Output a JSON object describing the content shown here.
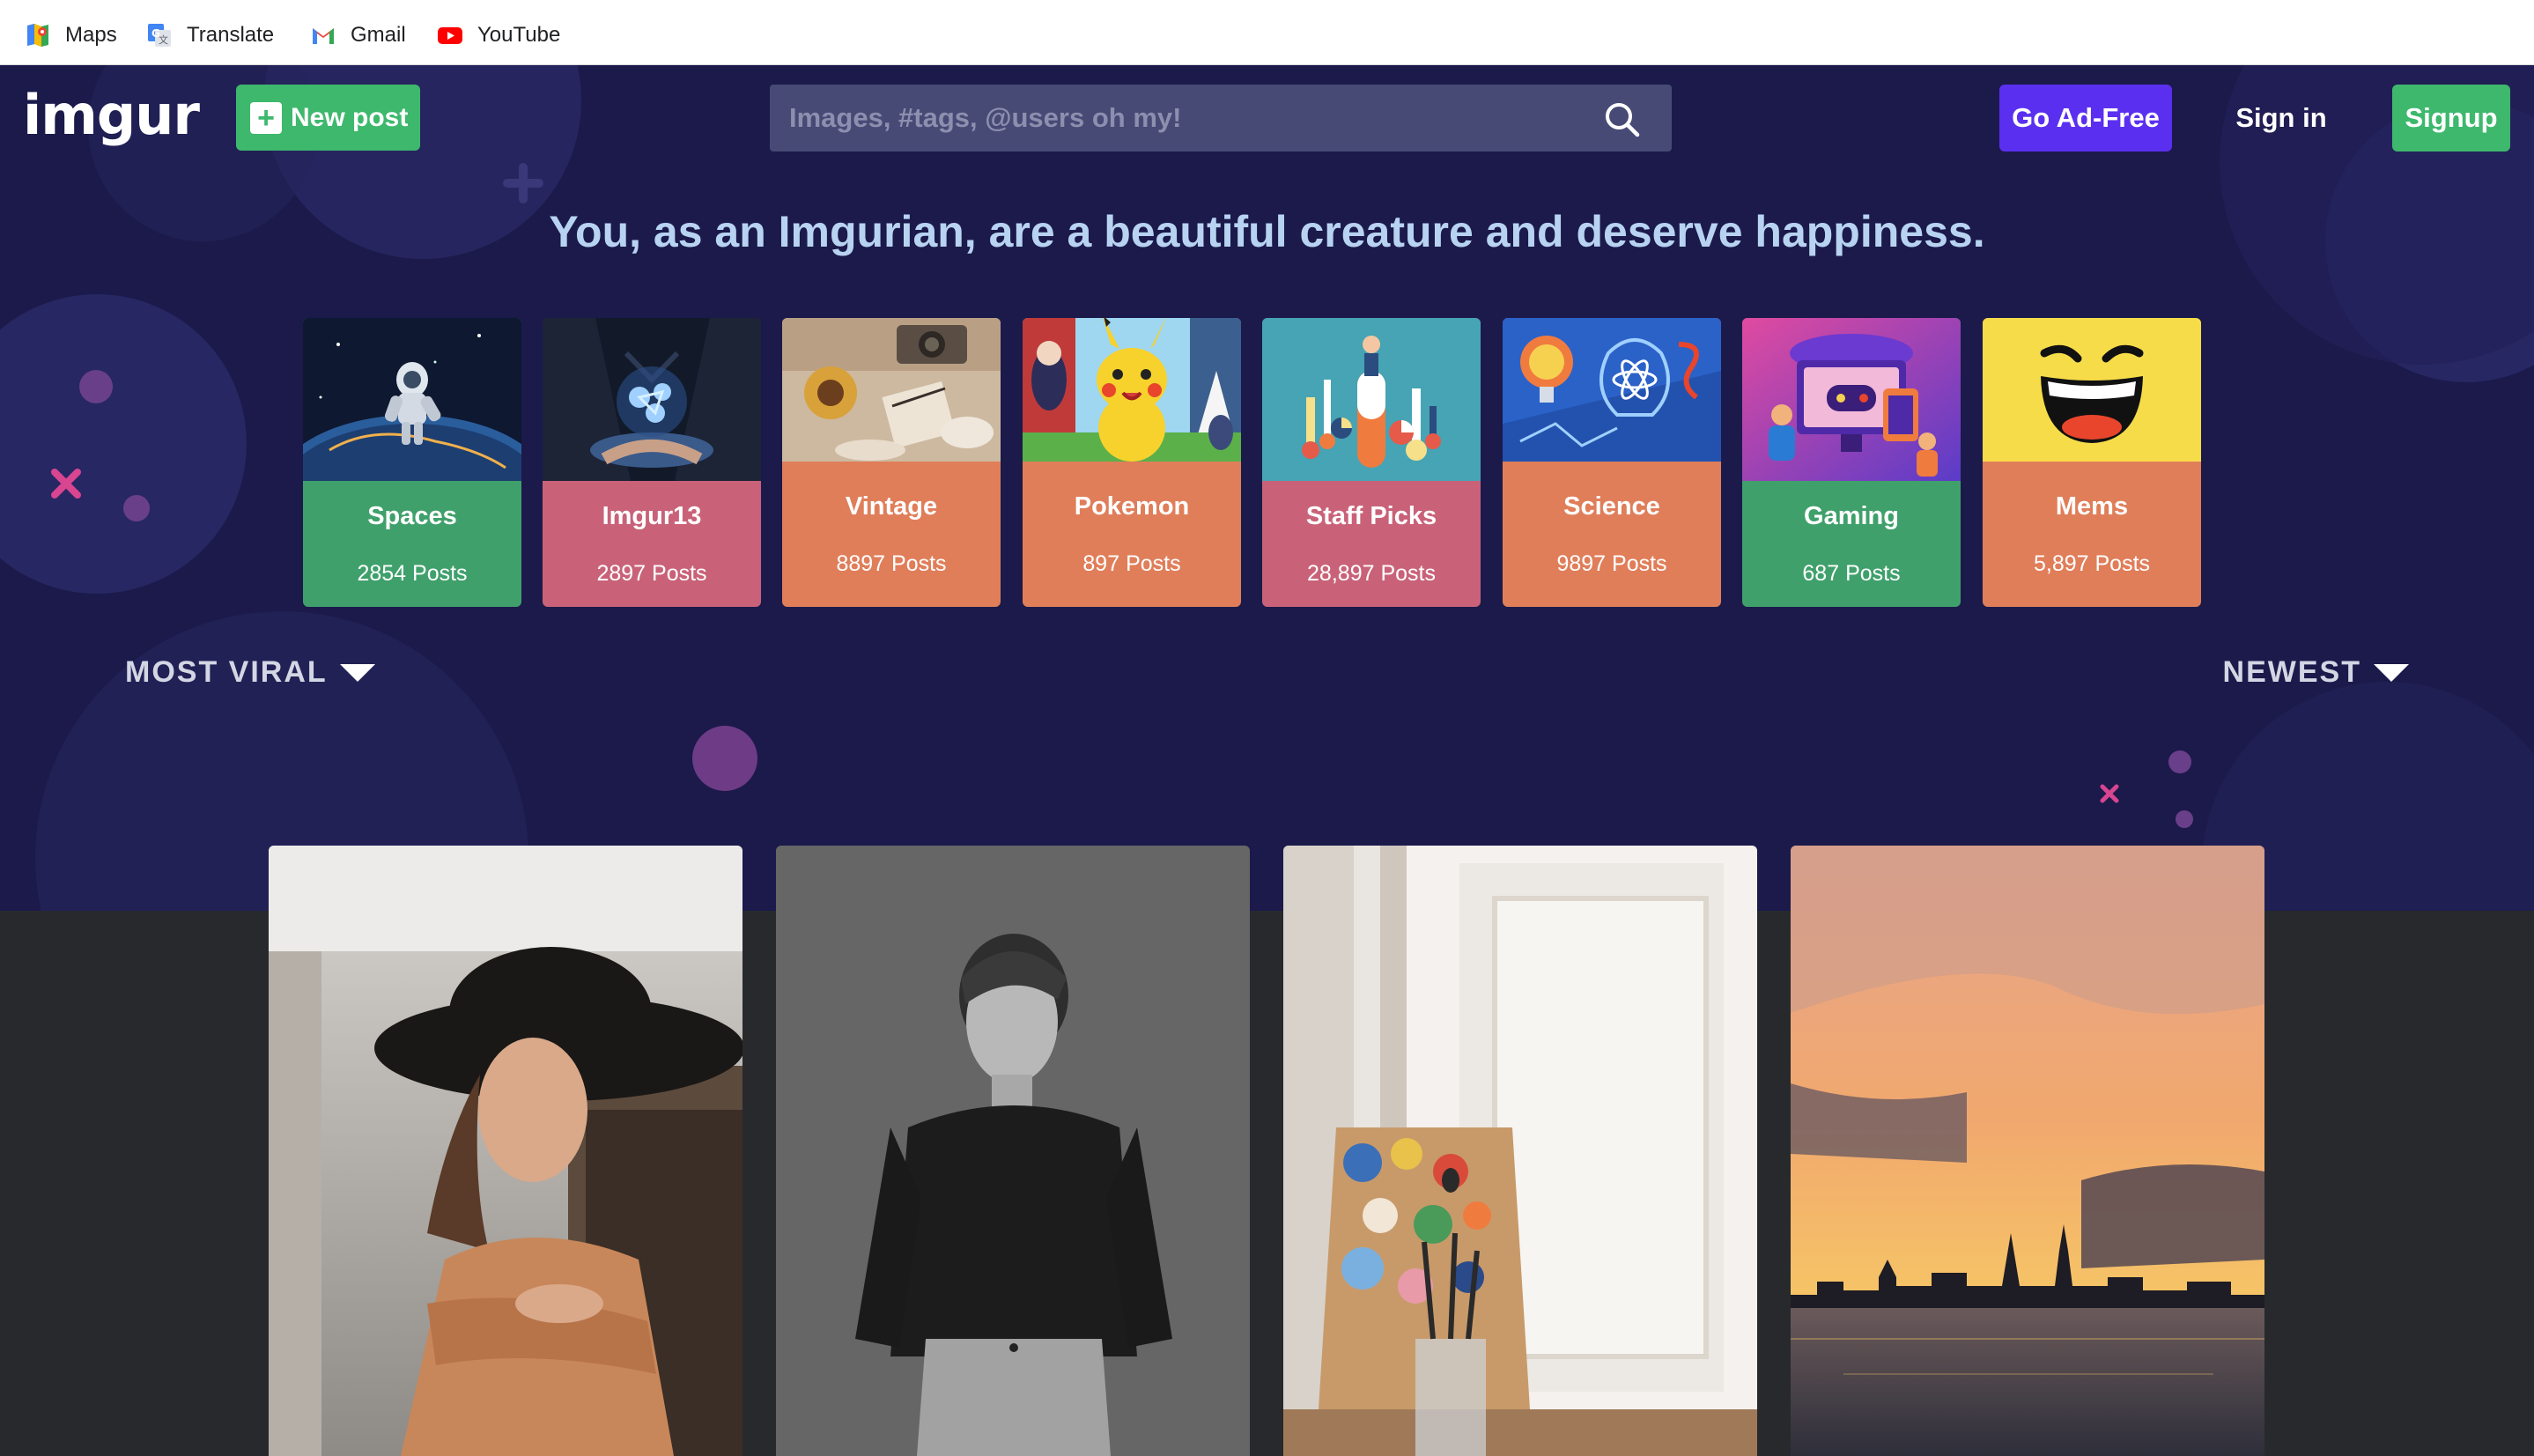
{
  "bookmarks": [
    {
      "label": "Maps",
      "icon": "maps-icon"
    },
    {
      "label": "Translate",
      "icon": "translate-icon"
    },
    {
      "label": "Gmail",
      "icon": "gmail-icon"
    },
    {
      "label": "YouTube",
      "icon": "youtube-icon"
    }
  ],
  "header": {
    "logo": "imgur",
    "new_post_label": "New post",
    "search_placeholder": "Images, #tags, @users oh my!",
    "go_adfree_label": "Go Ad-Free",
    "signin_label": "Sign in",
    "signup_label": "Signup"
  },
  "tagline": "You, as an Imgurian, are a beautiful creature and deserve happiness.",
  "tags": [
    {
      "name": "Spaces",
      "count": "2854 Posts",
      "color": "#3fa06b"
    },
    {
      "name": "Imgur13",
      "count": "2897 Posts",
      "color": "#c96278"
    },
    {
      "name": "Vintage",
      "count": "8897 Posts",
      "color": "#e07e5a"
    },
    {
      "name": "Pokemon",
      "count": "897 Posts",
      "color": "#e07e5a"
    },
    {
      "name": "Staff Picks",
      "count": "28,897 Posts",
      "color": "#c96278"
    },
    {
      "name": "Science",
      "count": "9897 Posts",
      "color": "#e07e5a"
    },
    {
      "name": "Gaming",
      "count": "687 Posts",
      "color": "#3fa06b"
    },
    {
      "name": "Mems",
      "count": "5,897 Posts",
      "color": "#e07e5a"
    }
  ],
  "sort": {
    "left_label": "MOST VIRAL",
    "right_label": "NEWEST"
  },
  "colors": {
    "hero_bg": "#1b1a4b",
    "feed_bg": "#27292d",
    "green": "#3eb86d",
    "purple": "#5b2ff0",
    "search_bg": "#474a75",
    "tagline": "#b8d3f2"
  }
}
